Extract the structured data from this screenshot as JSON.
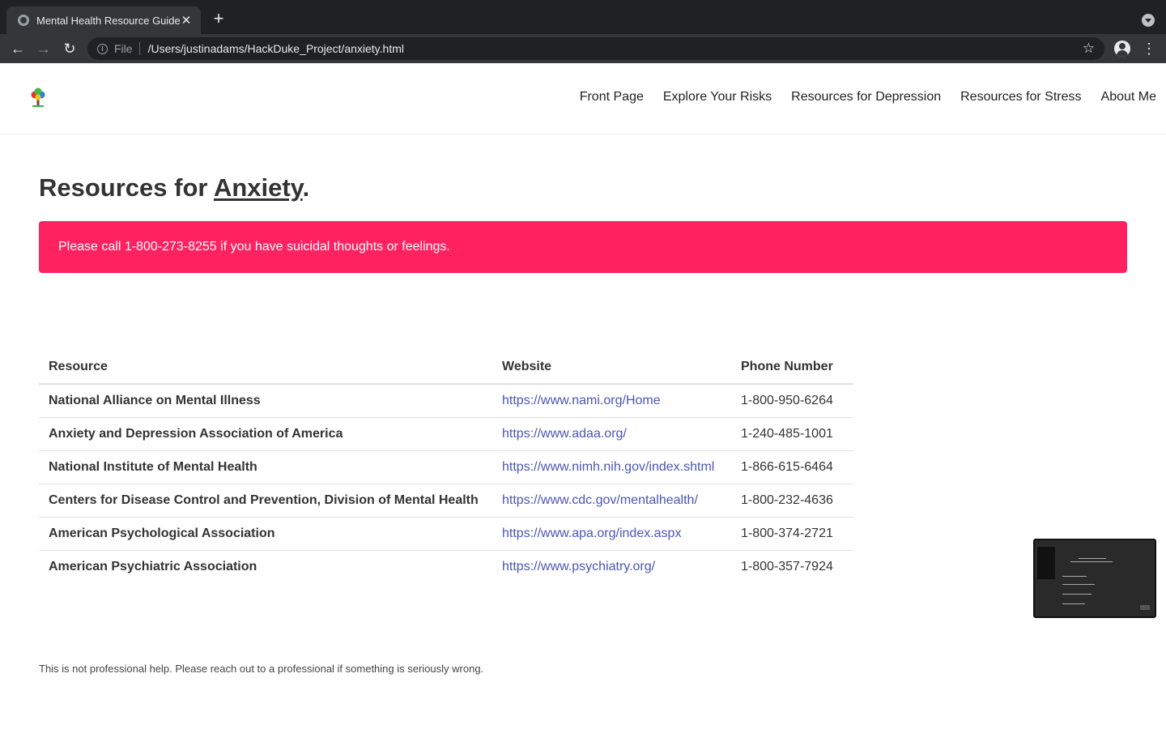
{
  "browser": {
    "tab_title": "Mental Health Resource Guide",
    "scheme": "File",
    "url": "/Users/justinadams/HackDuke_Project/anxiety.html"
  },
  "nav": {
    "links": [
      "Front Page",
      "Explore Your Risks",
      "Resources for Depression",
      "Resources for Stress",
      "About Me"
    ]
  },
  "heading": {
    "prefix": "Resources for ",
    "emphasis": "Anxiety",
    "suffix": "."
  },
  "alert": {
    "text": "Please call 1-800-273-8255 if you have suicidal thoughts or feelings.",
    "color": "#ff2160"
  },
  "table": {
    "headers": [
      "Resource",
      "Website",
      "Phone Number"
    ],
    "rows": [
      {
        "name": "National Alliance on Mental Illness",
        "url": "https://www.nami.org/Home",
        "phone": "1-800-950-6264"
      },
      {
        "name": "Anxiety and Depression Association of America",
        "url": "https://www.adaa.org/",
        "phone": "1-240-485-1001"
      },
      {
        "name": "National Institute of Mental Health",
        "url": "https://www.nimh.nih.gov/index.shtml",
        "phone": "1-866-615-6464"
      },
      {
        "name": "Centers for Disease Control and Prevention, Division of Mental Health",
        "url": "https://www.cdc.gov/mentalhealth/",
        "phone": "1-800-232-4636"
      },
      {
        "name": "American Psychological Association",
        "url": "https://www.apa.org/index.aspx",
        "phone": "1-800-374-2721"
      },
      {
        "name": "American Psychiatric Association",
        "url": "https://www.psychiatry.org/",
        "phone": "1-800-357-7924"
      }
    ]
  },
  "footer": {
    "text": "This is not professional help. Please reach out to a professional if something is seriously wrong."
  },
  "link_color": "#4a55b8",
  "icons": [
    "globe-icon",
    "close-icon",
    "plus-icon",
    "back-arrow-icon",
    "forward-arrow-icon",
    "reload-icon",
    "info-icon",
    "star-icon",
    "profile-icon",
    "kebab-menu-icon",
    "tree-logo-icon"
  ]
}
